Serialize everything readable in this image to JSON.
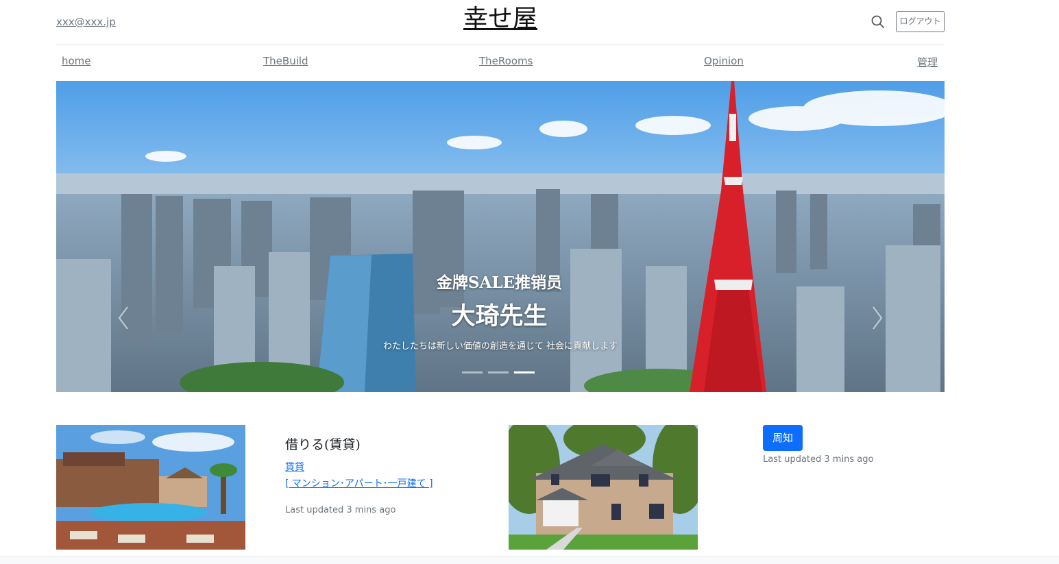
{
  "header": {
    "email": "xxx@xxx.jp",
    "title": "幸せ屋",
    "search_icon": "search-icon",
    "logout_label": "ログアウト"
  },
  "nav": {
    "items": [
      {
        "label": "home"
      },
      {
        "label": "TheBuild"
      },
      {
        "label": "TheRooms"
      },
      {
        "label": "Opinion"
      },
      {
        "label": "管理"
      }
    ]
  },
  "carousel": {
    "subtitle": "金牌SALE推销员",
    "headline": "大琦先生",
    "description": "わたしたちは新しい価値の創造を通じて 社会に貢献します",
    "indicators": 3,
    "active_indicator": 3,
    "prev_icon": "chevron-left-icon",
    "next_icon": "chevron-right-icon"
  },
  "cards": {
    "rent": {
      "title": "借りる(賃貸)",
      "link_main": "賃貸",
      "link_types": "[ マンション･アパート･一戸建て ]",
      "updated": "Last updated 3 mins ago"
    },
    "notice": {
      "button_label": "周知",
      "updated": "Last updated 3 mins ago"
    }
  },
  "colors": {
    "primary": "#0d6efd",
    "muted": "#6c757d",
    "tower_red": "#d8202a"
  }
}
